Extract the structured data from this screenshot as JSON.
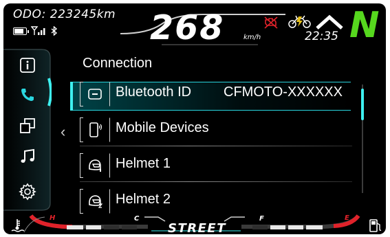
{
  "header": {
    "odometer": "ODO: 223245km",
    "speed": "268",
    "speed_unit": "km/h",
    "time": "22:35",
    "gear": "N"
  },
  "status_icons": [
    "battery-icon",
    "signal-icon",
    "bluetooth-icon",
    "engine-warning-icon",
    "motorcycle-icon",
    "navigation-arrow-icon"
  ],
  "sidebar": {
    "items": [
      {
        "icon": "info-icon"
      },
      {
        "icon": "phone-icon",
        "active": true
      },
      {
        "icon": "windows-icon"
      },
      {
        "icon": "music-icon"
      },
      {
        "icon": "gear-icon"
      }
    ]
  },
  "menu": {
    "title": "Connection",
    "items": [
      {
        "label": "Bluetooth ID",
        "value": "CFMOTO-XXXXXX",
        "icon": "bluetooth-id-icon",
        "selected": true
      },
      {
        "label": "Mobile Devices",
        "value": "",
        "icon": "mobile-device-icon"
      },
      {
        "label": "Helmet 1",
        "value": "",
        "icon": "helmet-1-icon"
      },
      {
        "label": "Helmet 2",
        "value": "",
        "icon": "helmet-2-icon"
      }
    ]
  },
  "footer": {
    "mode": "STREET",
    "temp_high": "H",
    "temp_cold": "C",
    "fuel_full": "F",
    "fuel_empty": "E"
  },
  "colors": {
    "accent": "#2ad7e0",
    "gear": "#56d81e",
    "warning": "#e0222a"
  }
}
